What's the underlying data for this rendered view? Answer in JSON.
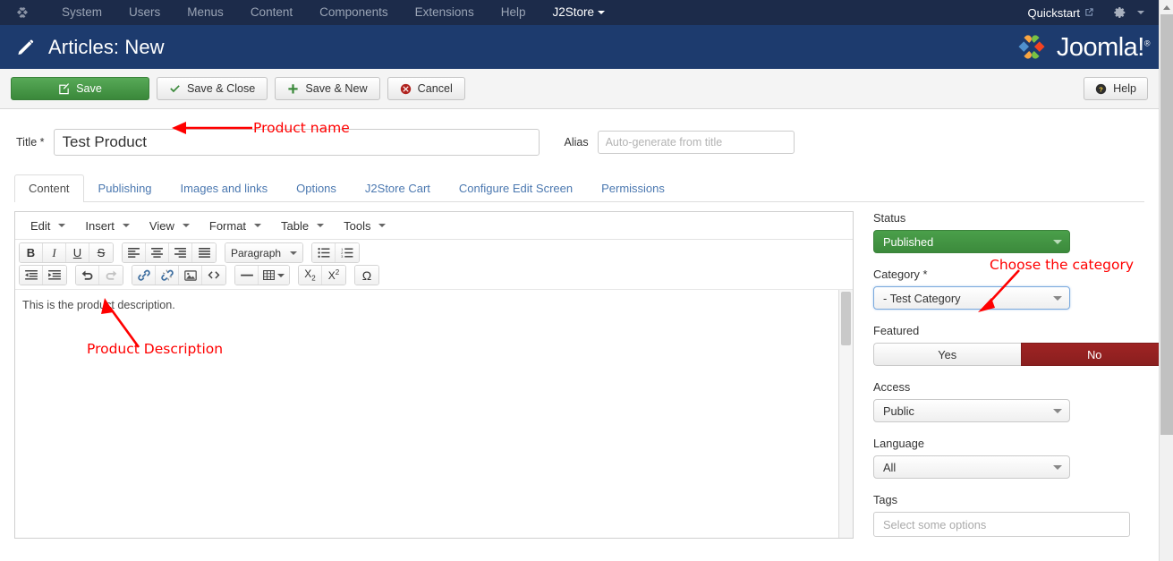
{
  "topbar": {
    "logo_icon": "joomla-logo-icon",
    "menu": [
      {
        "label": "System",
        "name": "menu-system"
      },
      {
        "label": "Users",
        "name": "menu-users"
      },
      {
        "label": "Menus",
        "name": "menu-menus"
      },
      {
        "label": "Content",
        "name": "menu-content"
      },
      {
        "label": "Components",
        "name": "menu-components"
      },
      {
        "label": "Extensions",
        "name": "menu-extensions"
      },
      {
        "label": "Help",
        "name": "menu-help"
      },
      {
        "label": "J2Store",
        "name": "menu-j2store"
      }
    ],
    "site_label": "Quickstart",
    "site_icon": "external-link-icon",
    "gear_icon": "gear-icon",
    "caret_icon": "chevron-down-icon"
  },
  "header": {
    "icon": "pencil-icon",
    "title": "Articles: New",
    "brand": "Joomla!",
    "brand_reg": "®"
  },
  "toolbar": {
    "save": "Save",
    "save_close": "Save & Close",
    "save_new": "Save & New",
    "cancel": "Cancel",
    "help": "Help",
    "save_icon": "edit-square-icon",
    "save_close_icon": "check-icon",
    "save_new_icon": "plus-icon",
    "cancel_icon": "cancel-circle-icon",
    "help_icon": "question-circle-icon"
  },
  "title_row": {
    "title_label": "Title *",
    "title_value": "Test Product",
    "alias_label": "Alias",
    "alias_placeholder": "Auto-generate from title"
  },
  "tabs": [
    {
      "label": "Content",
      "active": true
    },
    {
      "label": "Publishing",
      "active": false
    },
    {
      "label": "Images and links",
      "active": false
    },
    {
      "label": "Options",
      "active": false
    },
    {
      "label": "J2Store Cart",
      "active": false
    },
    {
      "label": "Configure Edit Screen",
      "active": false
    },
    {
      "label": "Permissions",
      "active": false
    }
  ],
  "editor": {
    "menu": [
      "Edit",
      "Insert",
      "View",
      "Format",
      "Table",
      "Tools"
    ],
    "paragraph_label": "Paragraph",
    "body_text": "This is the product description.",
    "toolbar_row1": [
      {
        "name": "bold-icon",
        "glyph": "B"
      },
      {
        "name": "italic-icon",
        "glyph": "I"
      },
      {
        "name": "underline-icon",
        "glyph": "U"
      },
      {
        "name": "strikethrough-icon",
        "glyph": "S"
      },
      {
        "name": "align-left-icon",
        "glyph": "≡"
      },
      {
        "name": "align-center-icon",
        "glyph": "≡"
      },
      {
        "name": "align-right-icon",
        "glyph": "≡"
      },
      {
        "name": "align-justify-icon",
        "glyph": "≡"
      },
      {
        "name": "bullet-list-icon",
        "glyph": "☰"
      },
      {
        "name": "numbered-list-icon",
        "glyph": "☰"
      }
    ],
    "toolbar_row2": [
      {
        "name": "outdent-icon",
        "glyph": "⇤"
      },
      {
        "name": "indent-icon",
        "glyph": "⇥"
      },
      {
        "name": "undo-icon",
        "glyph": "↶"
      },
      {
        "name": "redo-icon",
        "glyph": "↷"
      },
      {
        "name": "insert-link-icon",
        "glyph": "ὑ7"
      },
      {
        "name": "unlink-icon",
        "glyph": "✂"
      },
      {
        "name": "insert-image-icon",
        "glyph": "Ὓc"
      },
      {
        "name": "source-code-icon",
        "glyph": "<>"
      },
      {
        "name": "horizontal-rule-icon",
        "glyph": "—"
      },
      {
        "name": "insert-table-icon",
        "glyph": "⊞"
      },
      {
        "name": "subscript-icon",
        "glyph": "X₂"
      },
      {
        "name": "superscript-icon",
        "glyph": "X²"
      },
      {
        "name": "special-character-icon",
        "glyph": "Ω"
      }
    ]
  },
  "sidebar": {
    "status_label": "Status",
    "status_value": "Published",
    "category_label": "Category *",
    "category_value": "- Test Category",
    "featured_label": "Featured",
    "featured_yes": "Yes",
    "featured_no": "No",
    "featured_selected": "No",
    "access_label": "Access",
    "access_value": "Public",
    "language_label": "Language",
    "language_value": "All",
    "tags_label": "Tags",
    "tags_placeholder": "Select some options"
  },
  "annotations": [
    {
      "name": "annotation-product-name",
      "text": "Product name"
    },
    {
      "name": "annotation-product-description",
      "text": "Product Description"
    },
    {
      "name": "annotation-choose-category",
      "text": "Choose the category"
    }
  ],
  "colors": {
    "topbar_bg": "#1c2b4a",
    "header_bg": "#1d3b6e",
    "save_green": "#3c8a3c",
    "status_green": "#4a9f4a",
    "danger_red": "#9e2323",
    "link_blue": "#4b78b0",
    "annotation_red": "#ff0000"
  }
}
